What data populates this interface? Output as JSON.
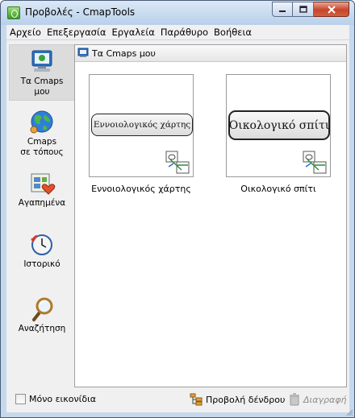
{
  "window": {
    "title": "Προβολές - CmapTools",
    "buttons": {
      "minimize": "–",
      "maximize": "□",
      "close": "✕"
    }
  },
  "menu": [
    {
      "label": "Αρχείο"
    },
    {
      "label": "Επεξεργασία"
    },
    {
      "label": "Εργαλεία"
    },
    {
      "label": "Παράθυρο"
    },
    {
      "label": "Βοήθεια"
    }
  ],
  "sidebar": {
    "items": [
      {
        "label": "Τα Cmaps\nμου",
        "icon": "my-cmaps-icon",
        "active": true
      },
      {
        "label": "Cmaps\nσε τόπους",
        "icon": "globe-icon",
        "active": false
      },
      {
        "label": "Αγαπημένα",
        "icon": "favorites-icon",
        "active": false
      },
      {
        "label": "Ιστορικό",
        "icon": "history-clock-icon",
        "active": false
      },
      {
        "label": "Αναζήτηση",
        "icon": "search-magnifier-icon",
        "active": false
      }
    ]
  },
  "main": {
    "header_title": "Τα Cmaps μου",
    "maps": [
      {
        "node_text": "Εννοιολογικός χάρτης",
        "caption": "Εννοιολογικός χάρτης"
      },
      {
        "node_text": "Οικολογικό σπίτι",
        "caption": "Οικολογικό σπίτι"
      }
    ]
  },
  "footer": {
    "icons_only_label": "Μόνο εικονίδια",
    "icons_only_checked": false,
    "tree_view_label": "Προβολή δένδρου",
    "delete_label": "Διαγραφή"
  },
  "colors": {
    "title_bar": "#c6d8ec",
    "close_button": "#c5452b",
    "active_sidebar_item": "#dcdcdc"
  }
}
